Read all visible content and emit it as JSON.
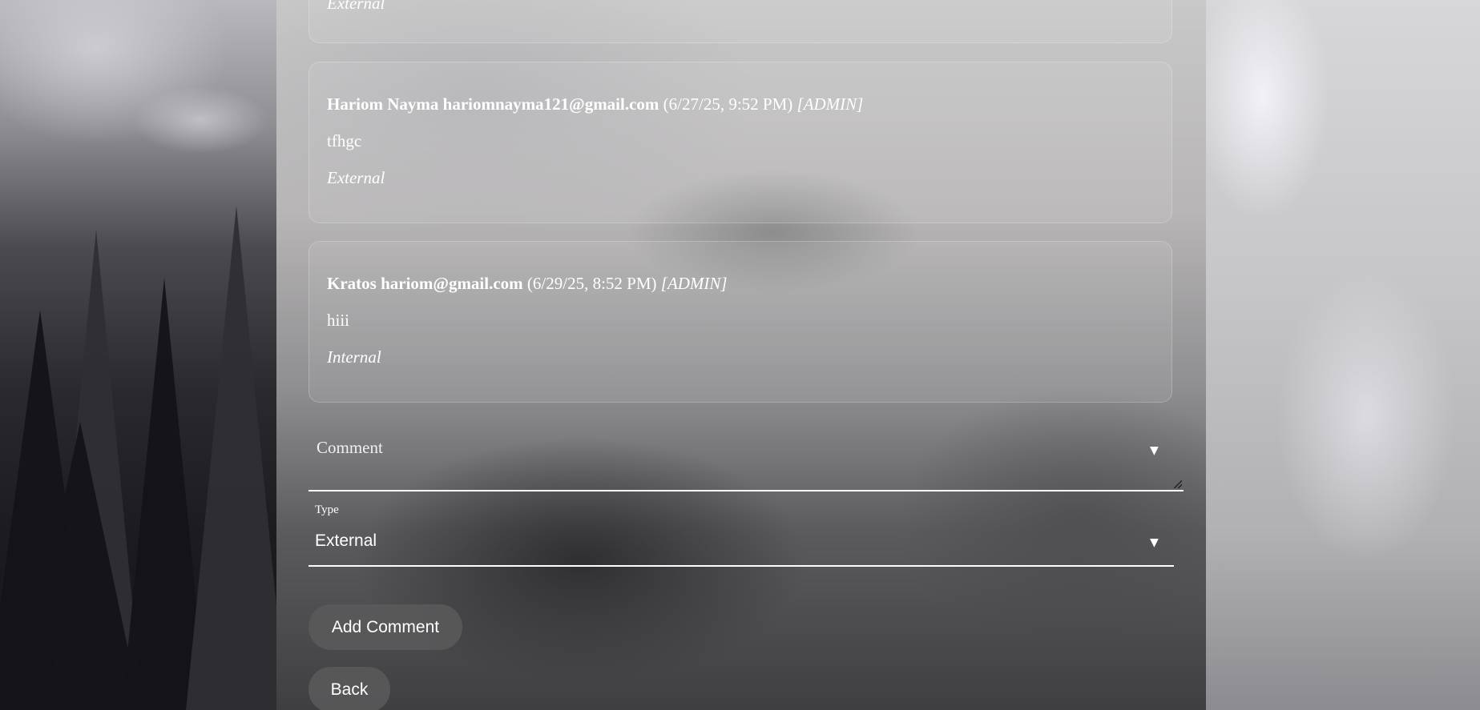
{
  "comments": [
    {
      "author": "",
      "email": "",
      "timestamp": "",
      "role": "",
      "text": "",
      "type": "External"
    },
    {
      "author": "Hariom Nayma",
      "email": "hariomnayma121@gmail.com",
      "timestamp": "(6/27/25, 9:52 PM)",
      "role": "[ADMIN]",
      "text": "tfhgc",
      "type": "External"
    },
    {
      "author": "Kratos",
      "email": "hariom@gmail.com",
      "timestamp": "(6/29/25, 8:52 PM)",
      "role": "[ADMIN]",
      "text": "hiii",
      "type": "Internal"
    }
  ],
  "form": {
    "comment_placeholder": "Comment",
    "type_label": "Type",
    "type_value": "External",
    "dropdown_arrow": "▼",
    "add_button": "Add Comment",
    "back_button": "Back"
  }
}
